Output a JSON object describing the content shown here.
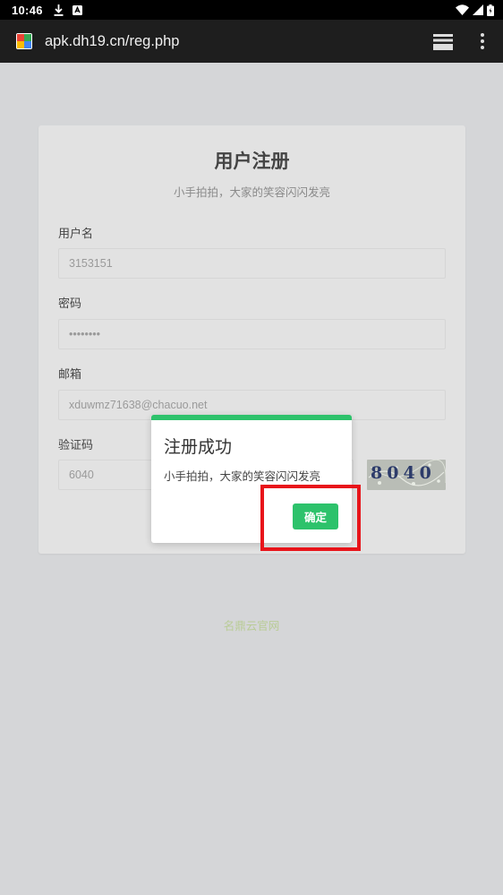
{
  "status_bar": {
    "time": "10:46"
  },
  "browser": {
    "url": "apk.dh19.cn/reg.php"
  },
  "form": {
    "title": "用户注册",
    "subtitle": "小手拍拍，大家的笑容闪闪发亮",
    "fields": [
      {
        "label": "用户名",
        "value": "3153151"
      },
      {
        "label": "密码",
        "value": "••••••••"
      },
      {
        "label": "邮箱",
        "value": "xduwmz71638@chacuo.net"
      },
      {
        "label": "验证码",
        "value": "6040"
      }
    ],
    "captcha_text": "8040"
  },
  "footer": {
    "link": "名鼎云官网"
  },
  "dialog": {
    "title": "注册成功",
    "message": "小手拍拍，大家的笑容闪闪发亮",
    "confirm_label": "确定",
    "accent_color": "#2dc26b"
  },
  "highlight": {
    "color": "#e8141a"
  }
}
